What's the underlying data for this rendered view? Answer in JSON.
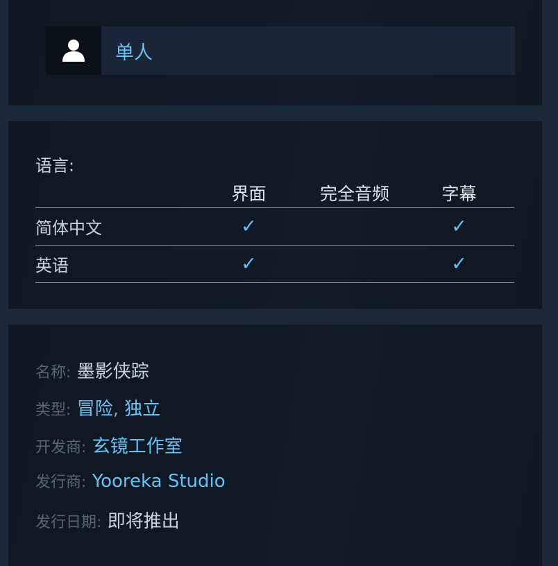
{
  "players": {
    "mode_icon": "single-player-icon",
    "mode_label": "单人"
  },
  "languages": {
    "heading": "语言:",
    "columns": [
      "界面",
      "完全音频",
      "字幕"
    ],
    "check_glyph": "✓",
    "rows": [
      {
        "name": "简体中文",
        "interface": true,
        "full_audio": false,
        "subtitles": true
      },
      {
        "name": "英语",
        "interface": true,
        "full_audio": false,
        "subtitles": true
      }
    ]
  },
  "details": {
    "name_label": "名称:",
    "name_value": "墨影侠踪",
    "genre_label": "类型:",
    "genres": [
      "冒险",
      "独立"
    ],
    "genre_separator": ",",
    "developer_label": "开发商:",
    "developer_value": "玄镜工作室",
    "publisher_label": "发行商:",
    "publisher_value": "Yooreka Studio",
    "release_label": "发行日期:",
    "release_value": "即将推出"
  },
  "colors": {
    "page_background": "#1b2838",
    "panel_background": "#111a27",
    "accent_link": "#67c1f5",
    "text_primary": "#c6d4df",
    "text_label": "#556772"
  }
}
